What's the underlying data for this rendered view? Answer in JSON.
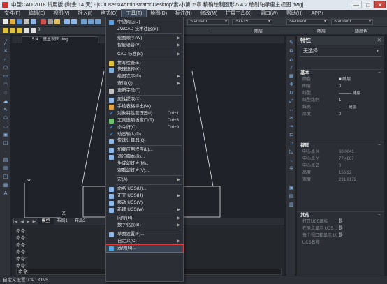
{
  "window": {
    "title": "中望CAD 2018 试用版 (剩余 14 天) - [C:\\Users\\Administrator\\Desktop\\素材\\第05章 精确绘制图形\\5.4.2 绘制轴承座主视图.dwg]",
    "controls": [
      "—",
      "□",
      "✕"
    ]
  },
  "menubar": [
    {
      "label": "文件(F)"
    },
    {
      "label": "编辑(E)"
    },
    {
      "label": "视图(V)"
    },
    {
      "label": "插入(I)"
    },
    {
      "label": "格式(O)"
    },
    {
      "label": "工具(T)",
      "active": true
    },
    {
      "label": "绘图(D)"
    },
    {
      "label": "标注(N)"
    },
    {
      "label": "修改(M)"
    },
    {
      "label": "扩展工具(X)"
    },
    {
      "label": "窗口(W)"
    },
    {
      "label": "帮助(H)"
    },
    {
      "label": "APP+"
    }
  ],
  "toolbar": {
    "style1": "Standard",
    "style2": "ISO-25",
    "style3": "Standard",
    "style4": "Standard",
    "layer_value": "0",
    "linetype1": "随层",
    "linetype2": "随层",
    "color_value": "随颜色"
  },
  "document": {
    "tab_label": "5.4... 座主视图.dwg"
  },
  "layout_tabs": [
    "模型",
    "布局1",
    "布局2"
  ],
  "axis": {
    "y": "Y",
    "x": "X"
  },
  "command": {
    "lines": [
      "命令:",
      "命令:",
      "命令:",
      "命令:",
      "命令:",
      "命令:"
    ],
    "prompt": "命令:"
  },
  "status": {
    "text": "自定义设置: OPTIONS"
  },
  "properties": {
    "title": "特性",
    "close": "✕",
    "selection": "无选择",
    "sections": [
      {
        "header": "基本",
        "rows": [
          {
            "k": "颜色",
            "v": "■ 随层"
          },
          {
            "k": "图层",
            "v": "0"
          },
          {
            "k": "线型",
            "v": "——— 随层"
          },
          {
            "k": "线型比例",
            "v": "1"
          },
          {
            "k": "线宽",
            "v": "—— 随层"
          },
          {
            "k": "厚度",
            "v": "0"
          }
        ]
      },
      {
        "header": "视图",
        "rows": [
          {
            "k": "中心点 X",
            "v": "60.0041"
          },
          {
            "k": "中心点 Y",
            "v": "77.4887"
          },
          {
            "k": "中心点 Z",
            "v": "0"
          },
          {
            "k": "高度",
            "v": "156.92"
          },
          {
            "k": "宽度",
            "v": "291.6172"
          }
        ]
      },
      {
        "header": "其他",
        "rows": [
          {
            "k": "打开UCS图标",
            "v": "是"
          },
          {
            "k": "在原点显示 UCS ...",
            "v": "是"
          },
          {
            "k": "每个视口都显示 U...",
            "v": "是"
          },
          {
            "k": "UCS名称",
            "v": ""
          }
        ]
      }
    ]
  },
  "tools_menu": [
    {
      "label": "中望网店(J)",
      "icon": "store-icon",
      "color": "#5aa0e6"
    },
    {
      "label": "ZWCAD 技术社区(B)",
      "icon": "",
      "color": ""
    },
    {
      "sep": true
    },
    {
      "label": "绘图顺序(W)",
      "submenu": true
    },
    {
      "label": "智能语音(V)",
      "submenu": true
    },
    {
      "sep": true
    },
    {
      "label": "CAD 标准(S)",
      "submenu": true
    },
    {
      "sep": true
    },
    {
      "label": "拼写检查(E)",
      "icon": "spell-icon",
      "color": "#e0c040"
    },
    {
      "label": "快速选择(K)...",
      "icon": "select-icon",
      "color": "#7fb0e0"
    },
    {
      "label": "绘图次序(D)",
      "submenu": true
    },
    {
      "label": "查询(Q)",
      "submenu": true
    },
    {
      "label": "更新字段(T)",
      "icon": "field-icon",
      "color": "#c0c0c0"
    },
    {
      "sep": true
    },
    {
      "label": "属性提取(X)...",
      "icon": "attr-icon",
      "color": "#8fb8e8"
    },
    {
      "label": "手绘表格导出(W)",
      "icon": "table-icon",
      "color": "#e0a040"
    },
    {
      "label": "对象特性管理器(I)",
      "check": true,
      "shortcut": "Ctrl+1"
    },
    {
      "label": "工具选项板窗口(T)",
      "icon": "palette-icon",
      "color": "#70c070",
      "shortcut": "Ctrl+3"
    },
    {
      "label": "命令行(C)",
      "check": true,
      "shortcut": "Ctrl+9"
    },
    {
      "label": "动态输入(D)",
      "check": true
    },
    {
      "label": "快速计算器(Q)",
      "icon": "calc-icon",
      "color": "#8fb8e8"
    },
    {
      "sep": true
    },
    {
      "label": "加载应用程序(L)...",
      "icon": "load-icon",
      "color": "#8fb8e8"
    },
    {
      "label": "运行脚本(R)...",
      "icon": "script-icon",
      "color": "#8fb8e8"
    },
    {
      "label": "生成幻灯片(M)...",
      "icon": "",
      "color": ""
    },
    {
      "label": "观看幻灯片(V)...",
      "icon": "",
      "color": ""
    },
    {
      "sep": true
    },
    {
      "label": "宏(A)",
      "submenu": true
    },
    {
      "sep": true
    },
    {
      "label": "命名 UCS(U)...",
      "icon": "ucs-icon",
      "color": "#8fb8e8"
    },
    {
      "label": "正交 UCS(H)",
      "icon": "ucs2-icon",
      "color": "#8fb8e8",
      "submenu": true
    },
    {
      "label": "移动 UCS(V)",
      "icon": "ucs3-icon",
      "color": "#8fb8e8"
    },
    {
      "label": "新建 UCS(W)",
      "icon": "ucs4-icon",
      "color": "#8fb8e8",
      "submenu": true
    },
    {
      "sep": true
    },
    {
      "label": "向导(R)",
      "submenu": true
    },
    {
      "label": "数字化仪(B)",
      "submenu": true
    },
    {
      "sep": true
    },
    {
      "label": "草图设置(F)...",
      "icon": "draft-icon",
      "color": "#8fb8e8"
    },
    {
      "label": "自定义(C)",
      "submenu": true
    },
    {
      "label": "选项(N)...",
      "icon": "options-icon",
      "color": "#5aa0e6",
      "highlight": true
    }
  ],
  "colors": {
    "accent": "#e03a3a",
    "bg": "#1f2228",
    "panel": "#2b2e34"
  }
}
